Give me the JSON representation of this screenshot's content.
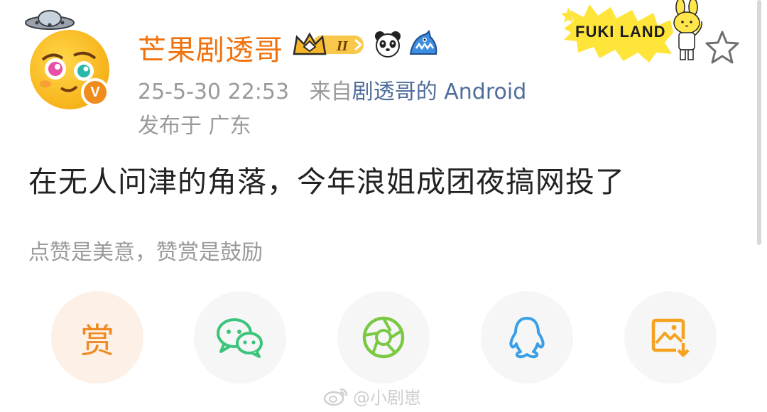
{
  "post": {
    "username": "芒果剧透哥",
    "level_badge": "II",
    "meta_datetime": "25-5-30 22:53",
    "meta_from_prefix": "来自",
    "meta_source": "剧透哥的 Android",
    "location": "发布于 广东",
    "content": "在无人问津的角落，今年浪姐成团夜搞网投了",
    "reward_hint": "点赞是美意，赞赏是鼓励"
  },
  "sticker": {
    "text": "FUKI LAND"
  },
  "share": {
    "reward_label": "赏",
    "items": [
      "reward",
      "wechat",
      "moments",
      "qq",
      "save-image"
    ]
  },
  "watermark": {
    "text": "@小剧崽"
  },
  "colors": {
    "username": "#f0720e",
    "link": "#4f6d9a",
    "muted": "#9a9a9a",
    "wechat": "#3cc47c",
    "moments": "#7ac943",
    "qq": "#3aa0e6",
    "save": "#f5a21e",
    "reward": "#f08a20"
  }
}
